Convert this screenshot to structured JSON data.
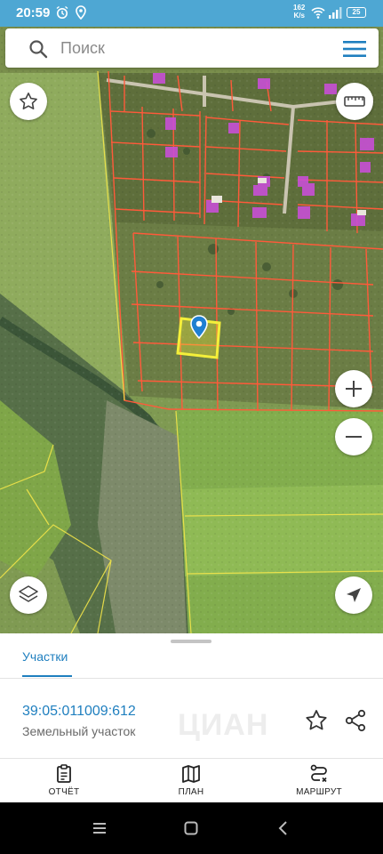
{
  "status_bar": {
    "time": "20:59",
    "net_speed_value": "162",
    "net_speed_unit": "K/s",
    "battery": "25"
  },
  "search": {
    "placeholder": "Поиск"
  },
  "map": {
    "icons": [
      "star-icon",
      "ruler-icon",
      "zoom-in-icon",
      "zoom-out-icon",
      "layers-icon",
      "navigation-arrow-icon",
      "location-pin-icon"
    ],
    "colors": {
      "parcel_border": "#ff5a3a",
      "selected_parcel": "#f4ef3a",
      "pin": "#1f7fd1",
      "building": "#c84fd6"
    }
  },
  "sheet": {
    "tab_label": "Участки",
    "watermark": "ЦИАН",
    "parcel_id": "39:05:011009:612",
    "parcel_type": "Земельный участок"
  },
  "bottom_nav": {
    "items": [
      {
        "label": "ОТЧЁТ",
        "icon": "clipboard-icon"
      },
      {
        "label": "ПЛАН",
        "icon": "map-icon"
      },
      {
        "label": "МАРШРУТ",
        "icon": "route-icon"
      }
    ]
  },
  "accent_color": "#1f7fbf"
}
